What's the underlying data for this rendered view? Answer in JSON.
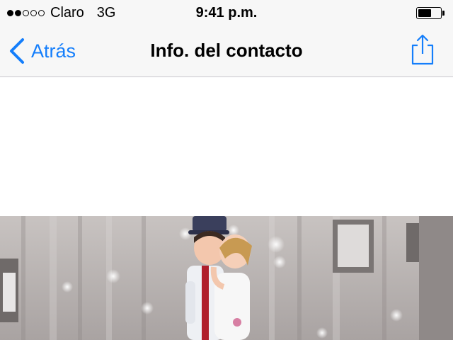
{
  "status_bar": {
    "carrier": "Claro",
    "network": "3G",
    "time": "9:41 p.m.",
    "signal_bars_filled": 2,
    "signal_bars_total": 5,
    "battery_level": 0.6
  },
  "nav": {
    "back_label": "Atrás",
    "title": "Info. del contacto",
    "back_icon": "chevron-left-icon",
    "share_icon": "share-icon",
    "accent_color": "#147efb"
  },
  "content": {
    "photo_description_icon": "photo"
  }
}
